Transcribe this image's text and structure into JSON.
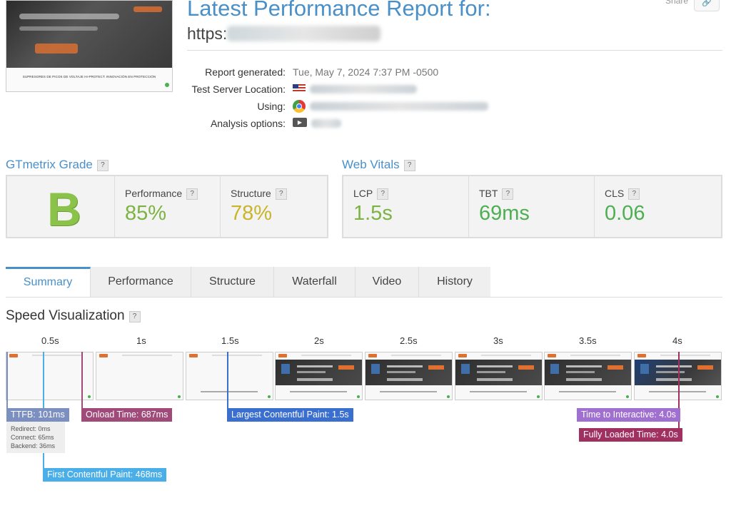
{
  "header": {
    "title": "Latest Performance Report for:",
    "url_prefix": "https:",
    "share_label": "Share"
  },
  "thumbnail": {
    "caption": "SUPRESORES DE PICOS DE VOLTAJE HI-PROTECT: INNOVACIÓN EN PROTECCIÓN"
  },
  "info": {
    "rows": [
      {
        "label": "Report generated:",
        "value": "Tue, May 7, 2024 7:37 PM -0500"
      },
      {
        "label": "Test Server Location:",
        "icon": "us-flag-icon"
      },
      {
        "label": "Using:",
        "icon": "chrome-icon"
      },
      {
        "label": "Analysis options:",
        "icon": "video-icon"
      }
    ]
  },
  "grade": {
    "title": "GTmetrix Grade",
    "letter": "B",
    "performance_label": "Performance",
    "performance_value": "85%",
    "structure_label": "Structure",
    "structure_value": "78%",
    "help": "?"
  },
  "vitals": {
    "title": "Web Vitals",
    "lcp_label": "LCP",
    "lcp_value": "1.5s",
    "tbt_label": "TBT",
    "tbt_value": "69ms",
    "cls_label": "CLS",
    "cls_value": "0.06"
  },
  "colors": {
    "accent": "#4a90c8",
    "grade_green": "#8bc34a",
    "value_green": "#7cb342",
    "value_yellow": "#c8b52a",
    "vital_green": "#4caf50",
    "ttfb": "#7b8fc0",
    "onload": "#a04a7a",
    "lcp": "#3a6fd0",
    "fcp": "#4aaee8",
    "tti": "#a070d0",
    "fully": "#a03060"
  },
  "tabs": [
    "Summary",
    "Performance",
    "Structure",
    "Waterfall",
    "Video",
    "History"
  ],
  "speed": {
    "title": "Speed Visualization",
    "ticks": [
      "0.5s",
      "1s",
      "1.5s",
      "2s",
      "2.5s",
      "3s",
      "3.5s",
      "4s"
    ],
    "markers": {
      "ttfb": "TTFB: 101ms",
      "redirect": "Redirect: 0ms",
      "connect": "Connect: 65ms",
      "backend": "Backend: 36ms",
      "onload": "Onload Time: 687ms",
      "lcp": "Largest Contentful Paint: 1.5s",
      "fcp": "First Contentful Paint: 468ms",
      "tti": "Time to Interactive: 4.0s",
      "fully": "Fully Loaded Time: 4.0s"
    }
  }
}
